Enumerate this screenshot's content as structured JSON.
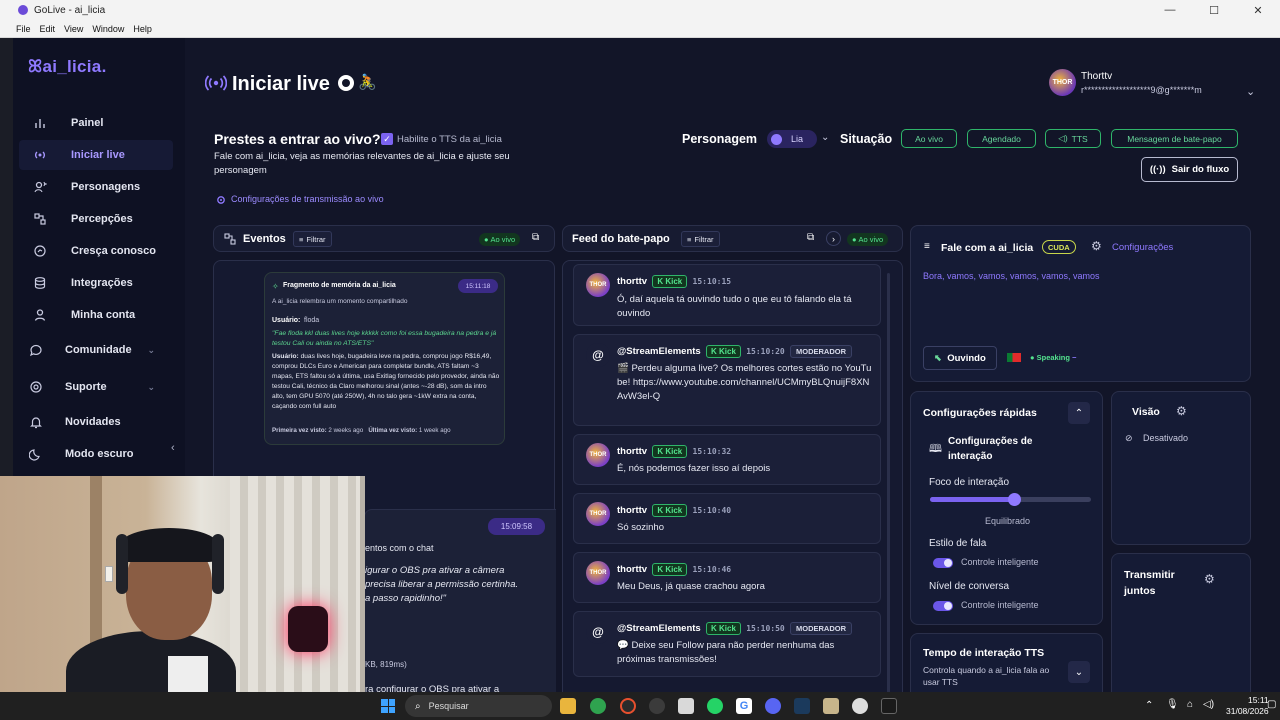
{
  "window": {
    "title": "GoLive - ai_licia",
    "menu": [
      "File",
      "Edit",
      "View",
      "Window",
      "Help"
    ]
  },
  "sidebar": {
    "logo": "ai_licia.",
    "items": [
      {
        "label": "Painel",
        "icon": "chart-icon"
      },
      {
        "label": "Iniciar live",
        "icon": "broadcast-icon",
        "active": true
      },
      {
        "label": "Personagens",
        "icon": "person-sparkle-icon"
      },
      {
        "label": "Percepções",
        "icon": "perception-icon"
      },
      {
        "label": "Cresça conosco",
        "icon": "growth-icon"
      },
      {
        "label": "Integrações",
        "icon": "database-icon"
      },
      {
        "label": "Minha conta",
        "icon": "user-icon"
      },
      {
        "label": "Comunidade",
        "icon": "chat-bubble-icon"
      },
      {
        "label": "Suporte",
        "icon": "lifebuoy-icon"
      },
      {
        "label": "Novidades",
        "icon": "bell-icon"
      },
      {
        "label": "Modo escuro",
        "icon": "moon-icon"
      }
    ]
  },
  "header": {
    "title": "Iniciar live",
    "user_name": "Thorttv",
    "user_email": "r*******************9@g*******m"
  },
  "intro": {
    "heading": "Prestes a entrar ao vivo?",
    "tts_checkbox_label": "Habilite o TTS da ai_licia",
    "description": "Fale com ai_licia, veja as memórias relevantes de ai_licia e ajuste seu personagem",
    "config_link": "Configurações de transmissão ao vivo"
  },
  "status_bar": {
    "persona_label": "Personagem",
    "persona_value": "Lia",
    "situation_label": "Situação",
    "pills": [
      "Ao vivo",
      "Agendado",
      "TTS",
      "Mensagem de bate-papo"
    ],
    "exit_button": "Sair do fluxo"
  },
  "events": {
    "title": "Eventos",
    "filter": "Filtrar",
    "live_badge": "Ao vivo",
    "memory_card": {
      "title": "Fragmento de memória da ai_licia",
      "time": "15:11:18",
      "subtitle": "A ai_licia relembra um momento compartilhado",
      "user_line_label": "Usuário:",
      "user_line_value": "floda",
      "quote": "\"Fae floda kkl duas lives hoje kkkkk como foi essa bugadeira na pedra e já testou Cali ou ainda no ATS/ETS\"",
      "summary_label": "Usuário:",
      "summary": "duas lives hoje, bugadeira leve na pedra, comprou jogo R$16,49, comprou DLCs Euro e American para completar bundle, ATS faltam ~3 mapas, ETS faltou só a última, usa Exitlag fornecido pelo provedor, ainda não testou Cali, técnico da Claro melhorou sinal (antes ~-28 dB), som da intro alto, tem GPU 5070 (até 250W), 4h no talo gera ~1kW extra na conta, caçando com full auto",
      "first_seen_label": "Primeira vez visto:",
      "first_seen": "2 weeks ago",
      "last_seen_label": "Última vez visto:",
      "last_seen": "1 week ago"
    },
    "second_card": {
      "time": "15:09:58",
      "line1": "entos com o chat",
      "quote": "igurar o OBS pra ativar a câmera\n precisa liberar a permissão certinha.\na passo rapidinho!\"",
      "size": "KB, 819ms)",
      "bottom": "ra configurar o OBS pra ativar a"
    }
  },
  "chat": {
    "title": "Feed do bate-papo",
    "filter": "Filtrar",
    "live_badge": "Ao vivo",
    "messages": [
      {
        "user": "thorttv",
        "platform": "Kick",
        "time": "15:10:15",
        "mod": "",
        "text": "Ó, daí aquela tá ouvindo tudo o que eu tô falando ela tá ouvindo"
      },
      {
        "user": "@StreamElements",
        "platform": "Kick",
        "time": "15:10:20",
        "mod": "MODERADOR",
        "text": "🎬 Perdeu alguma live? Os melhores cortes estão no YouTube! https://www.youtube.com/channel/UCMmyBLQnuijF8XNAvW3el-Q"
      },
      {
        "user": "thorttv",
        "platform": "Kick",
        "time": "15:10:32",
        "mod": "",
        "text": "É, nós podemos fazer isso aí depois"
      },
      {
        "user": "thorttv",
        "platform": "Kick",
        "time": "15:10:40",
        "mod": "",
        "text": "Só sozinho"
      },
      {
        "user": "thorttv",
        "platform": "Kick",
        "time": "15:10:46",
        "mod": "",
        "text": "Meu Deus, já quase crachou agora"
      },
      {
        "user": "@StreamElements",
        "platform": "Kick",
        "time": "15:10:50",
        "mod": "MODERADOR",
        "text": "💬 Deixe seu Follow para não perder nenhuma das próximas transmissões!"
      }
    ]
  },
  "talk": {
    "title": "Fale com a ai_licia",
    "badge": "CUDA",
    "settings": "Configurações",
    "transcript": "Bora, vamos, vamos, vamos, vamos, vamos",
    "listening_button": "Ouvindo",
    "speaking": "Speaking"
  },
  "quick": {
    "title": "Configurações rápidas",
    "interaction_title": "Configurações de interação",
    "focus_label": "Foco de interação",
    "focus_value": "Equilibrado",
    "focus_level": 0.52,
    "style_label": "Estilo de fala",
    "style_value": "Controle inteligente",
    "level_label": "Nível de conversa",
    "level_value": "Controle inteligente"
  },
  "vision": {
    "title": "Visão",
    "status": "Desativado"
  },
  "cotransmit": {
    "title": "Transmitir juntos"
  },
  "tts_time": {
    "title": "Tempo de interação TTS",
    "desc": "Controla quando a ai_licia fala ao usar TTS"
  },
  "taskbar": {
    "search": "Pesquisar",
    "time": "15:11",
    "date": "31/08/2026"
  },
  "colors": {
    "accent": "#7b63f0",
    "green": "#2fb56a",
    "bg": "#121528"
  }
}
